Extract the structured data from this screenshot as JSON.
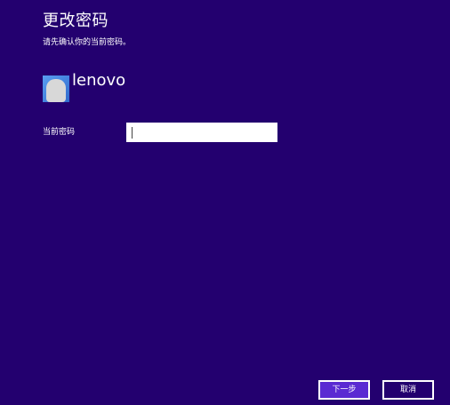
{
  "colors": {
    "background": "#23006f",
    "text": "#ffffff",
    "next_button_bg": "#5a2ad2",
    "input_bg": "#ffffff"
  },
  "header": {
    "title": "更改密码",
    "subtitle": "请先确认你的当前密码。"
  },
  "account": {
    "name": "lenovo",
    "avatar_icon": "user-avatar-icon"
  },
  "form": {
    "current_password_label": "当前密码",
    "current_password_value": "",
    "current_password_placeholder": ""
  },
  "buttons": {
    "next_label": "下一步",
    "cancel_label": "取消"
  }
}
